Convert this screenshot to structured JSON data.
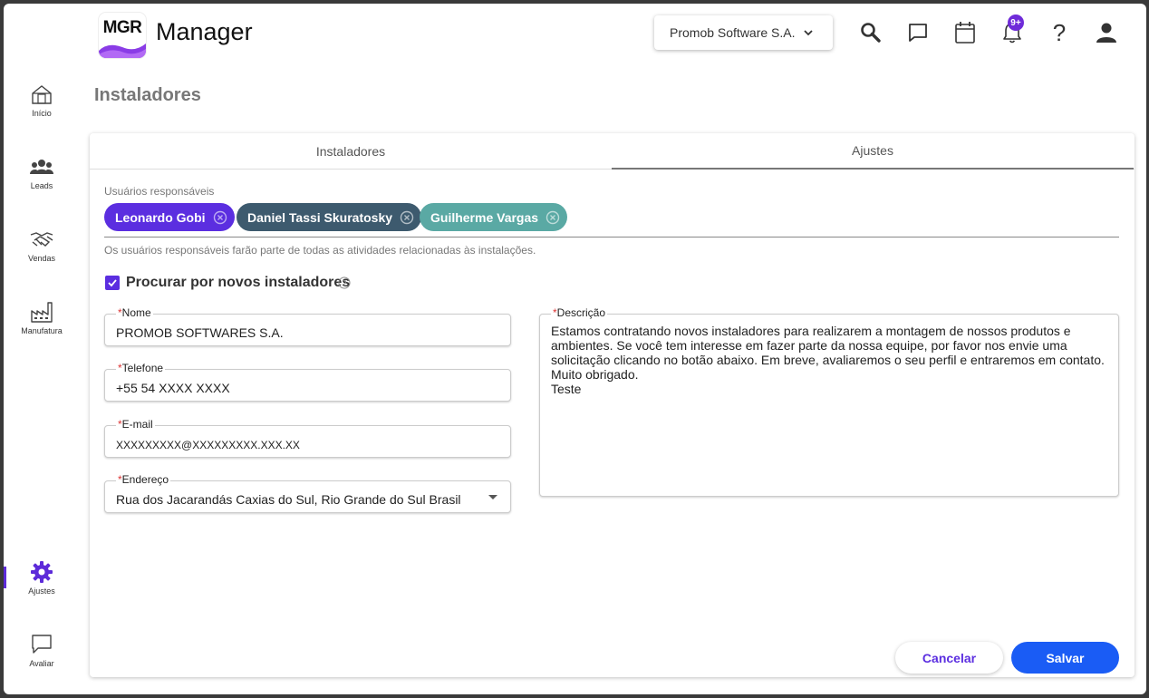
{
  "header": {
    "logo_text": "MGR",
    "app_title": "Manager",
    "company": "Promob Software S.A.",
    "notifications_badge": "9+",
    "help_glyph": "?"
  },
  "sidebar": {
    "items": [
      {
        "label": "Início",
        "icon": "home-icon"
      },
      {
        "label": "Leads",
        "icon": "people-icon"
      },
      {
        "label": "Vendas",
        "icon": "handshake-icon"
      },
      {
        "label": "Manufatura",
        "icon": "factory-icon"
      },
      {
        "label": "Ajustes",
        "icon": "gear-icon",
        "active": true
      },
      {
        "label": "Avaliar",
        "icon": "chat-icon"
      }
    ]
  },
  "page": {
    "title": "Instaladores"
  },
  "tabs": [
    {
      "label": "Instaladores",
      "active": false
    },
    {
      "label": "Ajustes",
      "active": true
    }
  ],
  "responsaveis": {
    "label": "Usuários responsáveis",
    "chips": [
      {
        "name": "Leonardo Gobi",
        "color": "#5b2ee0"
      },
      {
        "name": "Daniel Tassi Skuratosky",
        "color": "#3d5a6e"
      },
      {
        "name": "Guilherme Vargas",
        "color": "#5aa9a4"
      }
    ],
    "help": "Os usuários responsáveis farão parte de todas as atividades relacionadas às instalações."
  },
  "search_new": {
    "label": "Procurar por novos instaladores",
    "checked": true
  },
  "form": {
    "required_mark": "*",
    "nome": {
      "label": "Nome",
      "value": "PROMOB SOFTWARES S.A."
    },
    "telefone": {
      "label": "Telefone",
      "value": "+55 54  XXXX XXXX"
    },
    "email": {
      "label": "E-mail",
      "value": "XXXXXXXXX@XXXXXXXXX.XXX.XX"
    },
    "endereco": {
      "label": "Endereço",
      "value": "Rua dos Jacarandás Caxias do Sul, Rio Grande do Sul Brasil"
    },
    "descricao": {
      "label": "Descrição",
      "value": "Estamos contratando novos instaladores para realizarem a montagem de nossos produtos e ambientes. Se você tem interesse em fazer parte da nossa equipe, por favor nos envie uma solicitação clicando no botão abaixo. Em breve, avaliaremos o seu perfil e entraremos em contato.\nMuito obrigado.\nTeste"
    }
  },
  "actions": {
    "cancel": "Cancelar",
    "save": "Salvar"
  },
  "colors": {
    "accent": "#5b2ee0",
    "primary_button": "#1a5cf5"
  }
}
